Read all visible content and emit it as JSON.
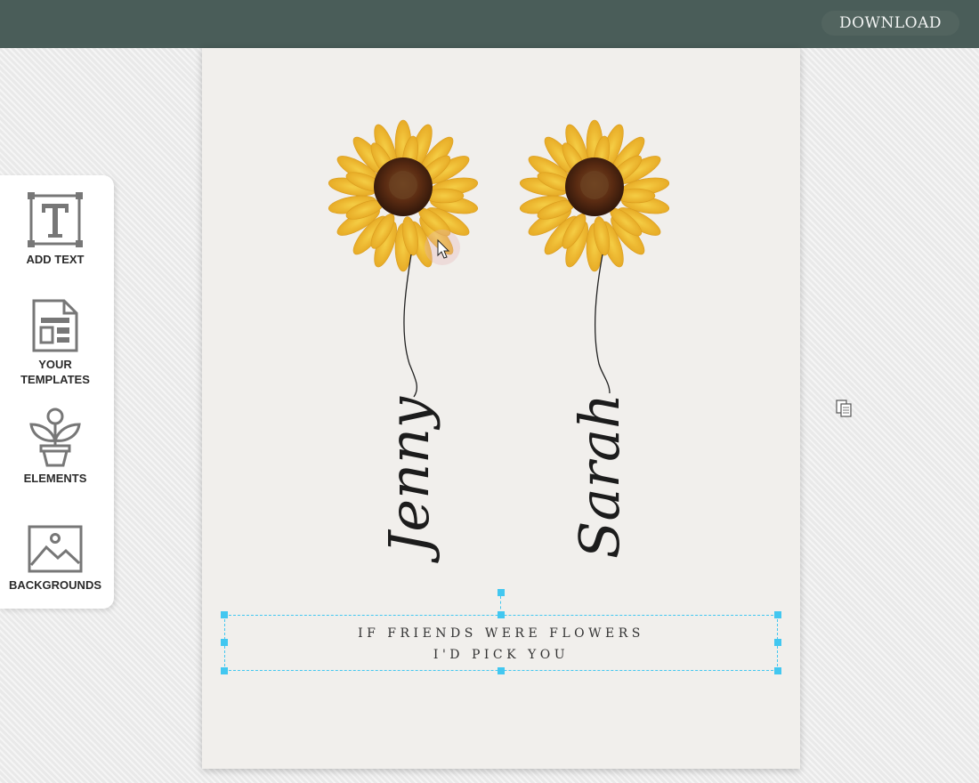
{
  "toolbar": {
    "download_label": "DOWNLOAD"
  },
  "sidebar": {
    "items": [
      {
        "label": "ADD TEXT",
        "icon": "text-icon"
      },
      {
        "label": "YOUR TEMPLATES",
        "icon": "templates-icon"
      },
      {
        "label": "ELEMENTS",
        "icon": "plant-icon"
      },
      {
        "label": "BACKGROUNDS",
        "icon": "image-icon"
      }
    ]
  },
  "design": {
    "names": [
      "Jenny",
      "Sarah"
    ],
    "quote_line1": "IF FRIENDS WERE FLOWERS",
    "quote_line2": "I'D PICK YOU"
  },
  "colors": {
    "topbar": "#4a5d59",
    "accent_selection": "#42c7f0",
    "petal": "#f4c430",
    "flower_center": "#5a2b12"
  }
}
